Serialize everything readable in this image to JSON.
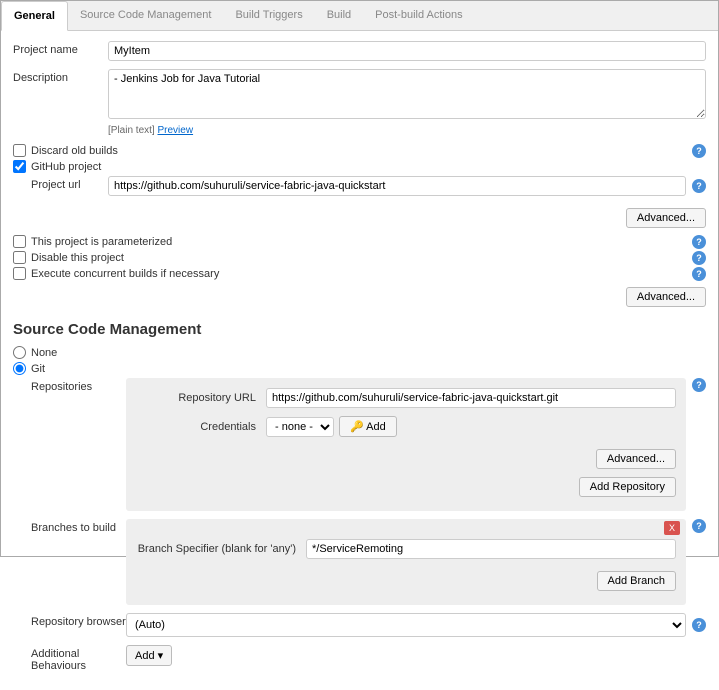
{
  "tabs": {
    "general": "General",
    "scm": "Source Code Management",
    "triggers": "Build Triggers",
    "build": "Build",
    "post": "Post-build Actions"
  },
  "labels": {
    "project_name": "Project name",
    "description": "Description",
    "plain_text": "[Plain text]",
    "preview": "Preview",
    "discard": "Discard old builds",
    "github": "GitHub project",
    "project_url": "Project url",
    "advanced": "Advanced...",
    "parameterized": "This project is parameterized",
    "disable": "Disable this project",
    "concurrent": "Execute concurrent builds if necessary",
    "scm_heading": "Source Code Management",
    "none": "None",
    "git": "Git",
    "repositories": "Repositories",
    "repo_url": "Repository URL",
    "credentials": "Credentials",
    "cred_none": "- none -",
    "cred_add": "Add",
    "add_repo": "Add Repository",
    "branches": "Branches to build",
    "branch_spec": "Branch Specifier (blank for 'any')",
    "add_branch": "Add Branch",
    "repo_browser": "Repository browser",
    "auto": "(Auto)",
    "additional": "Additional Behaviours",
    "add": "Add"
  },
  "values": {
    "project_name": "MyItem",
    "description": "- Jenkins Job for Java Tutorial",
    "project_url": "https://github.com/suhuruli/service-fabric-java-quickstart",
    "repo_url": "https://github.com/suhuruli/service-fabric-java-quickstart.git",
    "branch_spec": "*/ServiceRemoting"
  },
  "icons": {
    "help": "?",
    "delete": "X",
    "key": "🔑",
    "caret": "▾"
  }
}
